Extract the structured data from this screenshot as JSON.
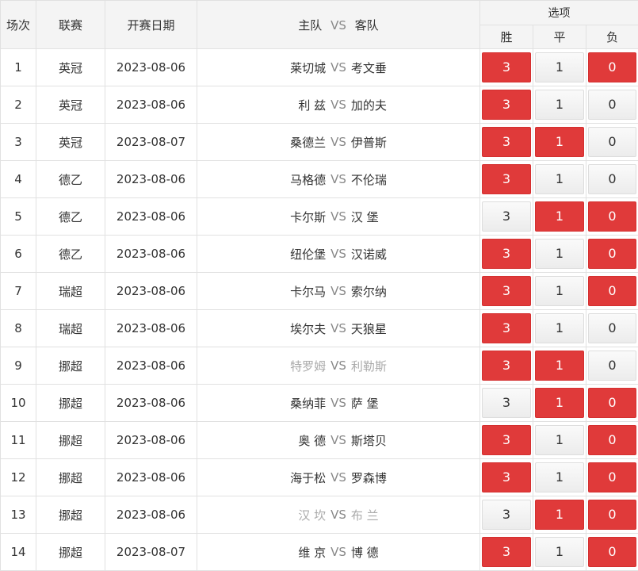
{
  "header": {
    "col_no": "场次",
    "col_league": "联赛",
    "col_date": "开赛日期",
    "col_home": "主队",
    "col_vs": "VS",
    "col_away": "客队",
    "col_options": "选项",
    "opt_win": "胜",
    "opt_draw": "平",
    "opt_lose": "负"
  },
  "vs_label": "VS",
  "rows": [
    {
      "no": "1",
      "league": "英冠",
      "date": "2023-08-06",
      "home": "莱切城",
      "away": "考文垂",
      "win": "3",
      "draw": "1",
      "lose": "0",
      "win_on": true,
      "draw_on": false,
      "lose_on": true,
      "muted": false
    },
    {
      "no": "2",
      "league": "英冠",
      "date": "2023-08-06",
      "home": "利 兹",
      "away": "加的夫",
      "win": "3",
      "draw": "1",
      "lose": "0",
      "win_on": true,
      "draw_on": false,
      "lose_on": false,
      "muted": false
    },
    {
      "no": "3",
      "league": "英冠",
      "date": "2023-08-07",
      "home": "桑德兰",
      "away": "伊普斯",
      "win": "3",
      "draw": "1",
      "lose": "0",
      "win_on": true,
      "draw_on": true,
      "lose_on": false,
      "muted": false
    },
    {
      "no": "4",
      "league": "德乙",
      "date": "2023-08-06",
      "home": "马格德",
      "away": "不伦瑞",
      "win": "3",
      "draw": "1",
      "lose": "0",
      "win_on": true,
      "draw_on": false,
      "lose_on": false,
      "muted": false
    },
    {
      "no": "5",
      "league": "德乙",
      "date": "2023-08-06",
      "home": "卡尔斯",
      "away": "汉 堡",
      "win": "3",
      "draw": "1",
      "lose": "0",
      "win_on": false,
      "draw_on": true,
      "lose_on": true,
      "muted": false
    },
    {
      "no": "6",
      "league": "德乙",
      "date": "2023-08-06",
      "home": "纽伦堡",
      "away": "汉诺威",
      "win": "3",
      "draw": "1",
      "lose": "0",
      "win_on": true,
      "draw_on": false,
      "lose_on": true,
      "muted": false
    },
    {
      "no": "7",
      "league": "瑞超",
      "date": "2023-08-06",
      "home": "卡尔马",
      "away": "索尔纳",
      "win": "3",
      "draw": "1",
      "lose": "0",
      "win_on": true,
      "draw_on": false,
      "lose_on": true,
      "muted": false
    },
    {
      "no": "8",
      "league": "瑞超",
      "date": "2023-08-06",
      "home": "埃尔夫",
      "away": "天狼星",
      "win": "3",
      "draw": "1",
      "lose": "0",
      "win_on": true,
      "draw_on": false,
      "lose_on": false,
      "muted": false
    },
    {
      "no": "9",
      "league": "挪超",
      "date": "2023-08-06",
      "home": "特罗姆",
      "away": "利勒斯",
      "win": "3",
      "draw": "1",
      "lose": "0",
      "win_on": true,
      "draw_on": true,
      "lose_on": false,
      "muted": true
    },
    {
      "no": "10",
      "league": "挪超",
      "date": "2023-08-06",
      "home": "桑纳菲",
      "away": "萨 堡",
      "win": "3",
      "draw": "1",
      "lose": "0",
      "win_on": false,
      "draw_on": true,
      "lose_on": true,
      "muted": false
    },
    {
      "no": "11",
      "league": "挪超",
      "date": "2023-08-06",
      "home": "奥 德",
      "away": "斯塔贝",
      "win": "3",
      "draw": "1",
      "lose": "0",
      "win_on": true,
      "draw_on": false,
      "lose_on": true,
      "muted": false
    },
    {
      "no": "12",
      "league": "挪超",
      "date": "2023-08-06",
      "home": "海于松",
      "away": "罗森博",
      "win": "3",
      "draw": "1",
      "lose": "0",
      "win_on": true,
      "draw_on": false,
      "lose_on": true,
      "muted": false
    },
    {
      "no": "13",
      "league": "挪超",
      "date": "2023-08-06",
      "home": "汉 坎",
      "away": "布 兰",
      "win": "3",
      "draw": "1",
      "lose": "0",
      "win_on": false,
      "draw_on": true,
      "lose_on": true,
      "muted": true
    },
    {
      "no": "14",
      "league": "挪超",
      "date": "2023-08-07",
      "home": "维 京",
      "away": "博 德",
      "win": "3",
      "draw": "1",
      "lose": "0",
      "win_on": true,
      "draw_on": false,
      "lose_on": true,
      "muted": false
    }
  ],
  "colors": {
    "selected": "#e03a3a",
    "header_bg": "#f4f4f4",
    "border": "#e1e1e1"
  }
}
